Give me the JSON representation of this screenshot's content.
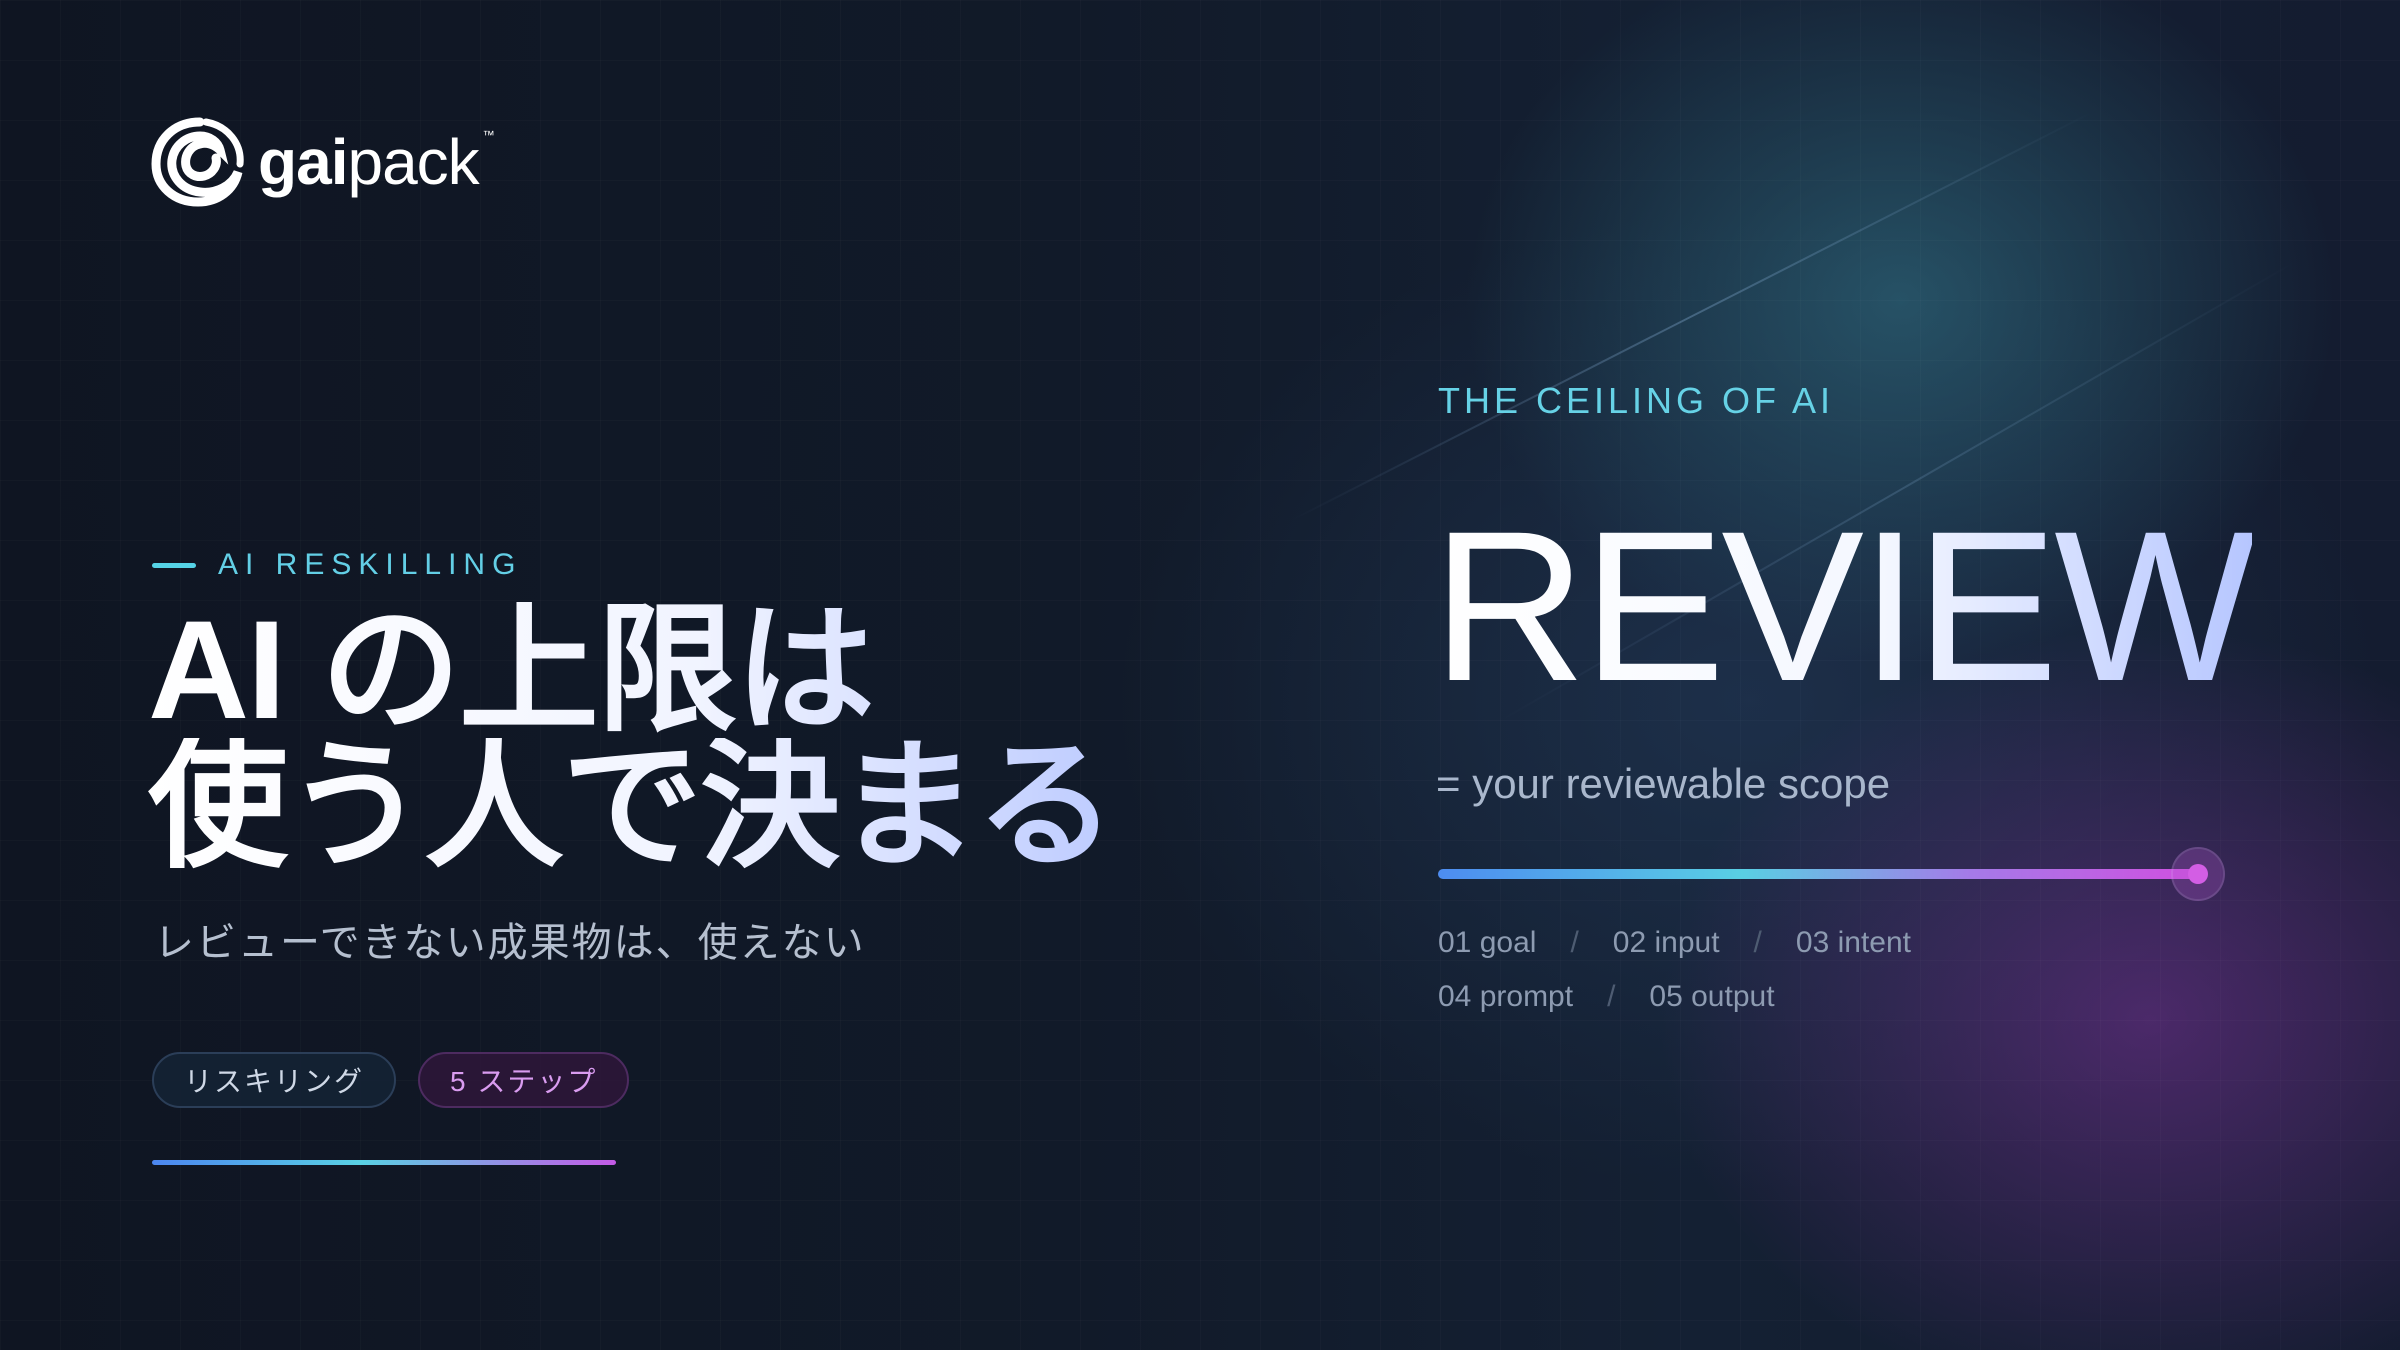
{
  "brand": {
    "logo_bold": "gai",
    "logo_light": "pack",
    "trademark": "™"
  },
  "left": {
    "eyebrow": "AI RESKILLING",
    "headline": [
      "AI の上限は",
      "使う人で決まる"
    ],
    "subhead": "レビューできない成果物は、使えない",
    "tags": [
      "リスキリング",
      "5 ステップ"
    ]
  },
  "right": {
    "kicker": "THE CEILING OF AI",
    "big_word": "REVIEW",
    "scope": "= your reviewable scope",
    "progress": 1.0,
    "steps_row1": [
      "01 goal",
      "02 input",
      "03 intent"
    ],
    "steps_row2": [
      "04 prompt",
      "05 output"
    ],
    "separator": "/"
  },
  "colors": {
    "accent_cyan": "#59d1e4",
    "accent_blue": "#4c86f0",
    "accent_magenta": "#d04fe0",
    "background": "#0f1624"
  },
  "icons": {
    "logo": "swirl-logo-icon"
  }
}
